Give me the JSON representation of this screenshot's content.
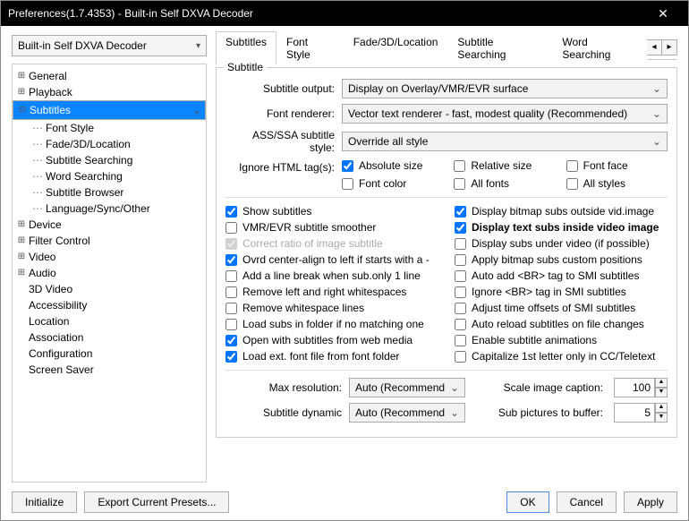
{
  "window": {
    "title": "Preferences(1.7.4353) - Built-in Self DXVA Decoder"
  },
  "left": {
    "combo": "Built-in Self DXVA Decoder",
    "tree": [
      {
        "label": "General",
        "exp": "+"
      },
      {
        "label": "Playback",
        "exp": "+"
      },
      {
        "label": "Subtitles",
        "exp": "-",
        "sel": true,
        "children": [
          {
            "label": "Font Style"
          },
          {
            "label": "Fade/3D/Location"
          },
          {
            "label": "Subtitle Searching"
          },
          {
            "label": "Word Searching"
          },
          {
            "label": "Subtitle Browser"
          },
          {
            "label": "Language/Sync/Other"
          }
        ]
      },
      {
        "label": "Device",
        "exp": "+"
      },
      {
        "label": "Filter Control",
        "exp": "+"
      },
      {
        "label": "Video",
        "exp": "+"
      },
      {
        "label": "Audio",
        "exp": "+"
      },
      {
        "label": "3D Video"
      },
      {
        "label": "Accessibility"
      },
      {
        "label": "Location"
      },
      {
        "label": "Association"
      },
      {
        "label": "Configuration"
      },
      {
        "label": "Screen Saver"
      }
    ]
  },
  "tabs": [
    "Subtitles",
    "Font Style",
    "Fade/3D/Location",
    "Subtitle Searching",
    "Word Searching"
  ],
  "group": {
    "title": "Subtitle",
    "rows": {
      "output_label": "Subtitle output:",
      "output_value": "Display on Overlay/VMR/EVR surface",
      "renderer_label": "Font renderer:",
      "renderer_value": "Vector text renderer - fast, modest quality (Recommended)",
      "ass_label": "ASS/SSA subtitle style:",
      "ass_value": "Override all style",
      "ignore_label": "Ignore HTML tag(s):"
    },
    "ignore_tags": [
      {
        "label": "Absolute size",
        "checked": true
      },
      {
        "label": "Relative size",
        "checked": false
      },
      {
        "label": "Font face",
        "checked": false
      },
      {
        "label": "Font color",
        "checked": false
      },
      {
        "label": "All fonts",
        "checked": false
      },
      {
        "label": "All styles",
        "checked": false
      }
    ],
    "left_checks": [
      {
        "label": "Show subtitles",
        "checked": true
      },
      {
        "label": "VMR/EVR subtitle smoother",
        "checked": false
      },
      {
        "label": "Correct ratio of image subtitle",
        "checked": true,
        "disabled": true
      },
      {
        "label": "Ovrd center-align to left if starts with a -",
        "checked": true
      },
      {
        "label": "Add a line break when sub.only 1 line",
        "checked": false
      },
      {
        "label": "Remove left and right whitespaces",
        "checked": false
      },
      {
        "label": "Remove whitespace lines",
        "checked": false
      },
      {
        "label": "Load subs in folder if no matching one",
        "checked": false
      },
      {
        "label": "Open with subtitles from web media",
        "checked": true
      },
      {
        "label": "Load ext. font file from font folder",
        "checked": true
      }
    ],
    "right_checks": [
      {
        "label": "Display bitmap subs outside vid.image",
        "checked": true
      },
      {
        "label": "Display text subs inside video image",
        "checked": true,
        "bold": true
      },
      {
        "label": "Display subs under video (if possible)",
        "checked": false
      },
      {
        "label": "Apply bitmap subs custom positions",
        "checked": false
      },
      {
        "label": "Auto add <BR> tag to SMI subtitles",
        "checked": false
      },
      {
        "label": "Ignore <BR> tag in SMI subtitles",
        "checked": false
      },
      {
        "label": "Adjust time offsets of SMI subtitles",
        "checked": false
      },
      {
        "label": "Auto reload subtitles on file changes",
        "checked": false
      },
      {
        "label": "Enable subtitle animations",
        "checked": false
      },
      {
        "label": "Capitalize 1st letter only in CC/Teletext",
        "checked": false
      }
    ],
    "bottom": {
      "maxres_label": "Max resolution:",
      "maxres_value": "Auto (Recommend",
      "scale_label": "Scale image caption:",
      "scale_value": "100",
      "dynamic_label": "Subtitle dynamic",
      "dynamic_value": "Auto (Recommend",
      "buffer_label": "Sub pictures to buffer:",
      "buffer_value": "5"
    }
  },
  "footer": {
    "initialize": "Initialize",
    "export": "Export Current Presets...",
    "ok": "OK",
    "cancel": "Cancel",
    "apply": "Apply"
  }
}
